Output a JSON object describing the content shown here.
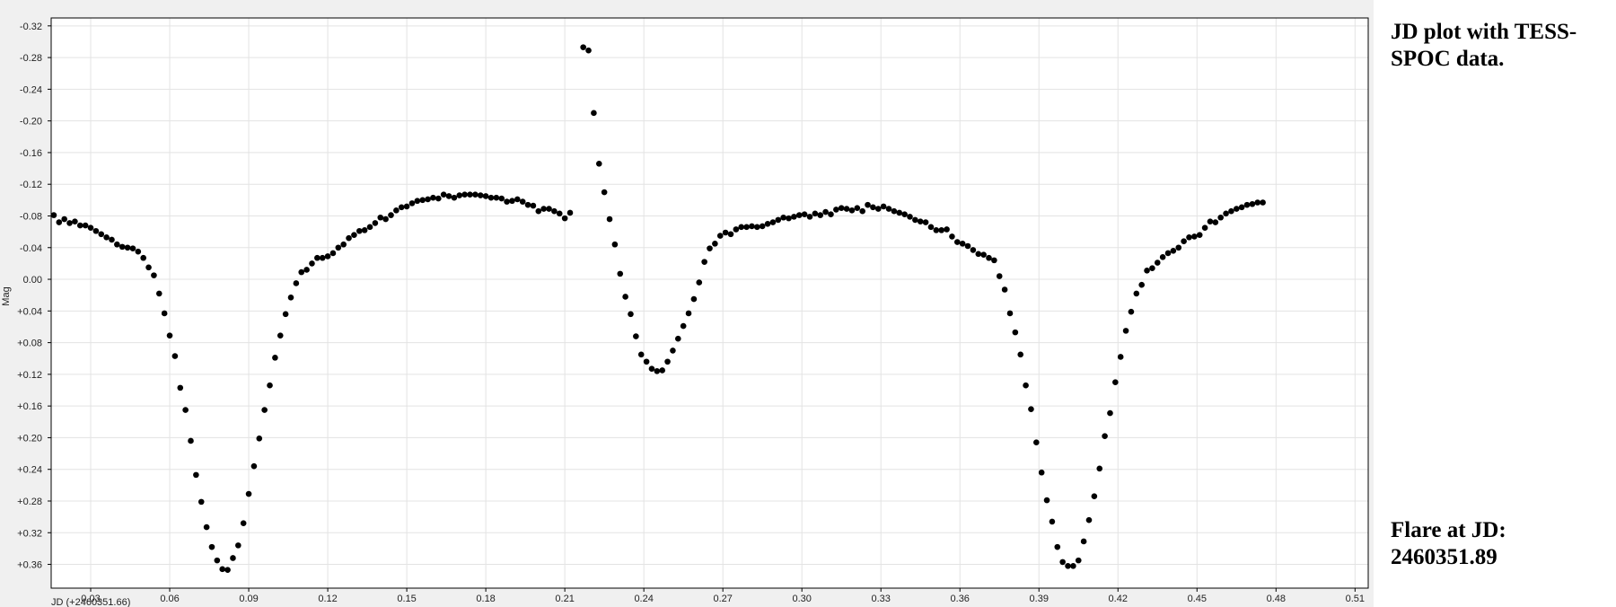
{
  "side_notes": {
    "top": "JD plot with TESS-SPOC data.",
    "bottom": "Flare at JD: 2460351.89"
  },
  "chart_data": {
    "type": "scatter",
    "title": "",
    "xlabel": "JD (+2460351.66)",
    "ylabel": "Mag",
    "xlim": [
      0.015,
      0.515
    ],
    "ylim": [
      -0.33,
      0.39
    ],
    "y_inverted": true,
    "grid": true,
    "x_ticks": [
      0.03,
      0.06,
      0.09,
      0.12,
      0.15,
      0.18,
      0.21,
      0.24,
      0.27,
      0.3,
      0.33,
      0.36,
      0.39,
      0.42,
      0.45,
      0.48,
      0.51
    ],
    "x_tick_labels": [
      "0.03",
      "0.06",
      "0.09",
      "0.12",
      "0.15",
      "0.18",
      "0.21",
      "0.24",
      "0.27",
      "0.30",
      "0.33",
      "0.36",
      "0.39",
      "0.42",
      "0.45",
      "0.48",
      "0.51"
    ],
    "y_ticks": [
      -0.32,
      -0.28,
      -0.24,
      -0.2,
      -0.16,
      -0.12,
      -0.08,
      -0.04,
      0.0,
      0.04,
      0.08,
      0.12,
      0.16,
      0.2,
      0.24,
      0.28,
      0.32,
      0.36
    ],
    "y_tick_labels": [
      "-0.32",
      "-0.28",
      "-0.24",
      "-0.20",
      "-0.16",
      "-0.12",
      "-0.08",
      "-0.04",
      "0.00",
      "+0.04",
      "+0.08",
      "+0.12",
      "+0.16",
      "+0.20",
      "+0.24",
      "+0.28",
      "+0.32",
      "+0.36"
    ],
    "colors": {
      "marker": "#000000",
      "grid": "#e3e3e3",
      "plot_bg": "#ffffff",
      "panel_bg": "#f0f0f0"
    },
    "series": [
      {
        "marker": "circle",
        "points": [
          [
            0.016,
            -0.081
          ],
          [
            0.018,
            -0.072
          ],
          [
            0.02,
            -0.076
          ],
          [
            0.022,
            -0.071
          ],
          [
            0.024,
            -0.073
          ],
          [
            0.026,
            -0.068
          ],
          [
            0.028,
            -0.068
          ],
          [
            0.03,
            -0.065
          ],
          [
            0.032,
            -0.061
          ],
          [
            0.034,
            -0.057
          ],
          [
            0.036,
            -0.053
          ],
          [
            0.038,
            -0.05
          ],
          [
            0.04,
            -0.044
          ],
          [
            0.042,
            -0.041
          ],
          [
            0.044,
            -0.04
          ],
          [
            0.046,
            -0.039
          ],
          [
            0.048,
            -0.035
          ],
          [
            0.05,
            -0.027
          ],
          [
            0.052,
            -0.015
          ],
          [
            0.054,
            -0.005
          ],
          [
            0.056,
            0.018
          ],
          [
            0.058,
            0.043
          ],
          [
            0.06,
            0.071
          ],
          [
            0.062,
            0.097
          ],
          [
            0.064,
            0.137
          ],
          [
            0.066,
            0.165
          ],
          [
            0.068,
            0.204
          ],
          [
            0.07,
            0.247
          ],
          [
            0.072,
            0.281
          ],
          [
            0.074,
            0.313
          ],
          [
            0.076,
            0.338
          ],
          [
            0.078,
            0.355
          ],
          [
            0.08,
            0.366
          ],
          [
            0.082,
            0.367
          ],
          [
            0.084,
            0.352
          ],
          [
            0.086,
            0.336
          ],
          [
            0.088,
            0.308
          ],
          [
            0.09,
            0.271
          ],
          [
            0.092,
            0.236
          ],
          [
            0.094,
            0.201
          ],
          [
            0.096,
            0.165
          ],
          [
            0.098,
            0.134
          ],
          [
            0.1,
            0.099
          ],
          [
            0.102,
            0.071
          ],
          [
            0.104,
            0.044
          ],
          [
            0.106,
            0.023
          ],
          [
            0.108,
            0.005
          ],
          [
            0.11,
            -0.009
          ],
          [
            0.112,
            -0.012
          ],
          [
            0.114,
            -0.02
          ],
          [
            0.116,
            -0.027
          ],
          [
            0.118,
            -0.027
          ],
          [
            0.12,
            -0.029
          ],
          [
            0.122,
            -0.033
          ],
          [
            0.124,
            -0.04
          ],
          [
            0.126,
            -0.044
          ],
          [
            0.128,
            -0.052
          ],
          [
            0.13,
            -0.056
          ],
          [
            0.132,
            -0.061
          ],
          [
            0.134,
            -0.062
          ],
          [
            0.136,
            -0.066
          ],
          [
            0.138,
            -0.071
          ],
          [
            0.14,
            -0.078
          ],
          [
            0.142,
            -0.076
          ],
          [
            0.144,
            -0.081
          ],
          [
            0.146,
            -0.087
          ],
          [
            0.148,
            -0.091
          ],
          [
            0.15,
            -0.092
          ],
          [
            0.152,
            -0.096
          ],
          [
            0.154,
            -0.099
          ],
          [
            0.156,
            -0.1
          ],
          [
            0.158,
            -0.101
          ],
          [
            0.16,
            -0.103
          ],
          [
            0.162,
            -0.102
          ],
          [
            0.164,
            -0.107
          ],
          [
            0.166,
            -0.105
          ],
          [
            0.168,
            -0.103
          ],
          [
            0.17,
            -0.106
          ],
          [
            0.172,
            -0.107
          ],
          [
            0.174,
            -0.107
          ],
          [
            0.176,
            -0.107
          ],
          [
            0.178,
            -0.106
          ],
          [
            0.18,
            -0.105
          ],
          [
            0.182,
            -0.103
          ],
          [
            0.184,
            -0.103
          ],
          [
            0.186,
            -0.102
          ],
          [
            0.188,
            -0.098
          ],
          [
            0.19,
            -0.099
          ],
          [
            0.192,
            -0.101
          ],
          [
            0.194,
            -0.098
          ],
          [
            0.196,
            -0.094
          ],
          [
            0.198,
            -0.093
          ],
          [
            0.2,
            -0.086
          ],
          [
            0.202,
            -0.089
          ],
          [
            0.204,
            -0.089
          ],
          [
            0.206,
            -0.086
          ],
          [
            0.208,
            -0.083
          ],
          [
            0.21,
            -0.077
          ],
          [
            0.212,
            -0.084
          ],
          [
            0.217,
            -0.293
          ],
          [
            0.219,
            -0.289
          ],
          [
            0.221,
            -0.21
          ],
          [
            0.223,
            -0.146
          ],
          [
            0.225,
            -0.11
          ],
          [
            0.227,
            -0.076
          ],
          [
            0.229,
            -0.044
          ],
          [
            0.231,
            -0.007
          ],
          [
            0.233,
            0.022
          ],
          [
            0.235,
            0.044
          ],
          [
            0.237,
            0.072
          ],
          [
            0.239,
            0.095
          ],
          [
            0.241,
            0.104
          ],
          [
            0.243,
            0.113
          ],
          [
            0.245,
            0.116
          ],
          [
            0.247,
            0.115
          ],
          [
            0.249,
            0.104
          ],
          [
            0.251,
            0.09
          ],
          [
            0.253,
            0.075
          ],
          [
            0.255,
            0.059
          ],
          [
            0.257,
            0.043
          ],
          [
            0.259,
            0.025
          ],
          [
            0.261,
            0.004
          ],
          [
            0.263,
            -0.022
          ],
          [
            0.265,
            -0.039
          ],
          [
            0.267,
            -0.045
          ],
          [
            0.269,
            -0.055
          ],
          [
            0.271,
            -0.059
          ],
          [
            0.273,
            -0.057
          ],
          [
            0.275,
            -0.063
          ],
          [
            0.277,
            -0.066
          ],
          [
            0.279,
            -0.066
          ],
          [
            0.281,
            -0.067
          ],
          [
            0.283,
            -0.066
          ],
          [
            0.285,
            -0.067
          ],
          [
            0.287,
            -0.07
          ],
          [
            0.289,
            -0.072
          ],
          [
            0.291,
            -0.075
          ],
          [
            0.293,
            -0.078
          ],
          [
            0.295,
            -0.077
          ],
          [
            0.297,
            -0.079
          ],
          [
            0.299,
            -0.081
          ],
          [
            0.301,
            -0.082
          ],
          [
            0.303,
            -0.079
          ],
          [
            0.305,
            -0.083
          ],
          [
            0.307,
            -0.081
          ],
          [
            0.309,
            -0.085
          ],
          [
            0.311,
            -0.082
          ],
          [
            0.313,
            -0.088
          ],
          [
            0.315,
            -0.09
          ],
          [
            0.317,
            -0.089
          ],
          [
            0.319,
            -0.087
          ],
          [
            0.321,
            -0.09
          ],
          [
            0.323,
            -0.086
          ],
          [
            0.325,
            -0.094
          ],
          [
            0.327,
            -0.091
          ],
          [
            0.329,
            -0.089
          ],
          [
            0.331,
            -0.092
          ],
          [
            0.333,
            -0.089
          ],
          [
            0.335,
            -0.086
          ],
          [
            0.337,
            -0.084
          ],
          [
            0.339,
            -0.082
          ],
          [
            0.341,
            -0.079
          ],
          [
            0.343,
            -0.075
          ],
          [
            0.345,
            -0.073
          ],
          [
            0.347,
            -0.072
          ],
          [
            0.349,
            -0.066
          ],
          [
            0.351,
            -0.062
          ],
          [
            0.353,
            -0.062
          ],
          [
            0.355,
            -0.063
          ],
          [
            0.357,
            -0.054
          ],
          [
            0.359,
            -0.047
          ],
          [
            0.361,
            -0.045
          ],
          [
            0.363,
            -0.042
          ],
          [
            0.365,
            -0.037
          ],
          [
            0.367,
            -0.032
          ],
          [
            0.369,
            -0.031
          ],
          [
            0.371,
            -0.027
          ],
          [
            0.373,
            -0.024
          ],
          [
            0.375,
            -0.004
          ],
          [
            0.377,
            0.013
          ],
          [
            0.379,
            0.043
          ],
          [
            0.381,
            0.067
          ],
          [
            0.383,
            0.095
          ],
          [
            0.385,
            0.134
          ],
          [
            0.387,
            0.164
          ],
          [
            0.389,
            0.206
          ],
          [
            0.391,
            0.244
          ],
          [
            0.393,
            0.279
          ],
          [
            0.395,
            0.306
          ],
          [
            0.397,
            0.338
          ],
          [
            0.399,
            0.357
          ],
          [
            0.401,
            0.362
          ],
          [
            0.403,
            0.362
          ],
          [
            0.405,
            0.355
          ],
          [
            0.407,
            0.331
          ],
          [
            0.409,
            0.304
          ],
          [
            0.411,
            0.274
          ],
          [
            0.413,
            0.239
          ],
          [
            0.415,
            0.198
          ],
          [
            0.417,
            0.169
          ],
          [
            0.419,
            0.13
          ],
          [
            0.421,
            0.098
          ],
          [
            0.423,
            0.065
          ],
          [
            0.425,
            0.041
          ],
          [
            0.427,
            0.018
          ],
          [
            0.429,
            0.007
          ],
          [
            0.431,
            -0.011
          ],
          [
            0.433,
            -0.014
          ],
          [
            0.435,
            -0.021
          ],
          [
            0.437,
            -0.028
          ],
          [
            0.439,
            -0.033
          ],
          [
            0.441,
            -0.036
          ],
          [
            0.443,
            -0.04
          ],
          [
            0.445,
            -0.048
          ],
          [
            0.447,
            -0.053
          ],
          [
            0.449,
            -0.054
          ],
          [
            0.451,
            -0.056
          ],
          [
            0.453,
            -0.065
          ],
          [
            0.455,
            -0.073
          ],
          [
            0.457,
            -0.072
          ],
          [
            0.459,
            -0.078
          ],
          [
            0.461,
            -0.083
          ],
          [
            0.463,
            -0.086
          ],
          [
            0.465,
            -0.089
          ],
          [
            0.467,
            -0.091
          ],
          [
            0.469,
            -0.094
          ],
          [
            0.471,
            -0.095
          ],
          [
            0.473,
            -0.097
          ],
          [
            0.475,
            -0.097
          ]
        ]
      }
    ]
  }
}
